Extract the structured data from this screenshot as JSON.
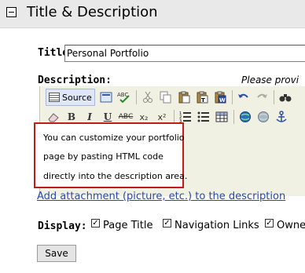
{
  "header": {
    "title": "Title & Description"
  },
  "form": {
    "title_label": "Title",
    "title_value": "Personal Portfolio",
    "description_label": "Description:",
    "description_note": "Please provi",
    "attach_link": "Add attachment (picture, etc.) to the description",
    "display_label": "Display:",
    "save_label": "Save"
  },
  "toolbar": {
    "source_label": "Source",
    "bold": "B",
    "italic": "I",
    "underline": "U",
    "strike": "ABC",
    "subscript": "x₂",
    "superscript": "x²",
    "spellcheck": "ABC"
  },
  "editor": {
    "content_lines": [
      "You can customize your portfolio",
      "page by pasting HTML code",
      "directly into the description area."
    ]
  },
  "display_options": [
    {
      "label": "Page Title",
      "checked": true
    },
    {
      "label": "Navigation Links",
      "checked": true
    },
    {
      "label": "Owne",
      "checked": true
    }
  ],
  "colors": {
    "header_bg": "#e9e9e9",
    "editor_bg": "#f1f1e3",
    "highlight_border": "#c41a1a",
    "link": "#2a47b0"
  }
}
